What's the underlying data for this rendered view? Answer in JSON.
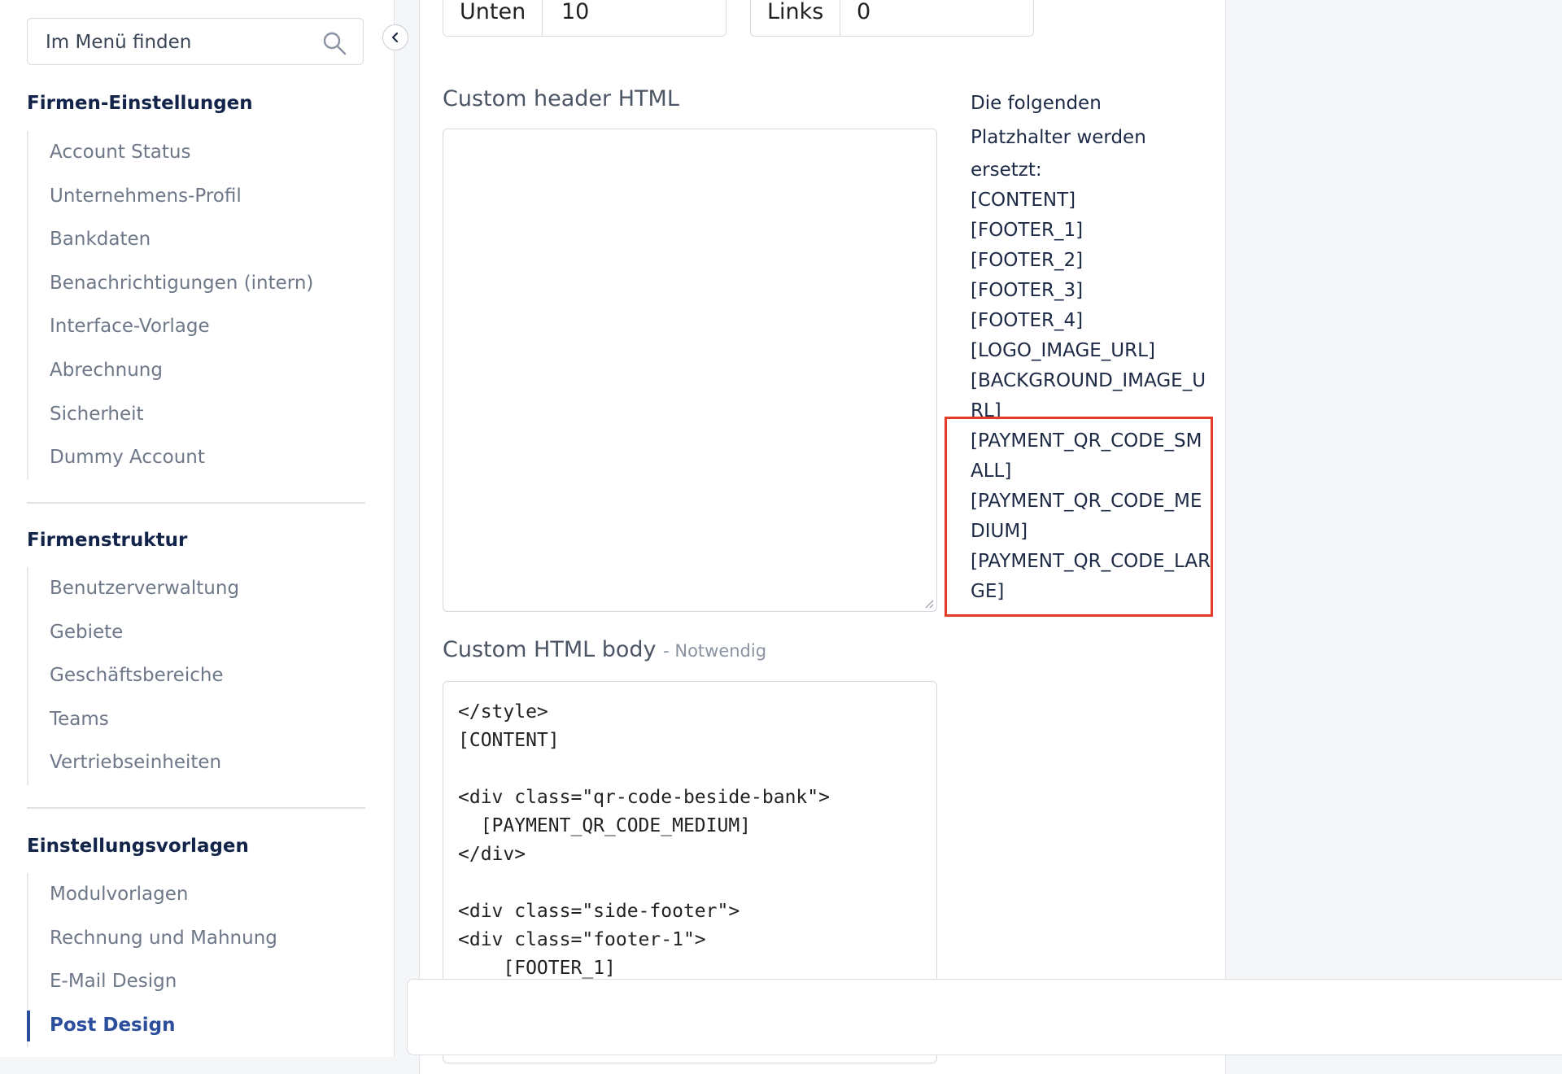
{
  "search": {
    "placeholder": "Im Menü finden"
  },
  "sidebar": {
    "sections": [
      {
        "title": "Firmen-Einstellungen",
        "items": [
          "Account Status",
          "Unternehmens-Profil",
          "Bankdaten",
          "Benachrichtigungen (intern)",
          "Interface-Vorlage",
          "Abrechnung",
          "Sicherheit",
          "Dummy Account"
        ]
      },
      {
        "title": "Firmenstruktur",
        "items": [
          "Benutzerverwaltung",
          "Gebiete",
          "Geschäftsbereiche",
          "Teams",
          "Vertriebseinheiten"
        ]
      },
      {
        "title": "Einstellungsvorlagen",
        "items": [
          "Modulvorlagen",
          "Rechnung und Mahnung",
          "E-Mail Design",
          "Post Design"
        ],
        "active_item": "Post Design"
      }
    ]
  },
  "margins": {
    "bottom": {
      "label": "Unten",
      "value": "10"
    },
    "left": {
      "label": "Links",
      "value": "0"
    }
  },
  "header_field": {
    "label": "Custom header HTML",
    "value": ""
  },
  "body_field": {
    "label": "Custom HTML body",
    "required_label": "- Notwendig",
    "value": "</style>\n[CONTENT]\n\n<div class=\"qr-code-beside-bank\">\n  [PAYMENT_QR_CODE_MEDIUM]\n</div>\n\n<div class=\"side-footer\">\n<div class=\"footer-1\">\n    [FOOTER_1]"
  },
  "placeholders_info": {
    "intro": [
      "Die folgenden",
      "Platzhalter werden",
      "ersetzt:"
    ],
    "items": [
      "[CONTENT]",
      "[FOOTER_1]",
      "[FOOTER_2]",
      "[FOOTER_3]",
      "[FOOTER_4]",
      "[LOGO_IMAGE_URL]",
      "[BACKGROUND_IMAGE_URL]",
      "[PAYMENT_QR_CODE_SMALL]",
      "[PAYMENT_QR_CODE_MEDIUM]",
      "[PAYMENT_QR_CODE_LARGE]"
    ],
    "highlight_color": "#e23d27"
  },
  "colors": {
    "accent": "#2b4f9c",
    "section_title": "#13244a",
    "nav_text": "#6e7888"
  }
}
